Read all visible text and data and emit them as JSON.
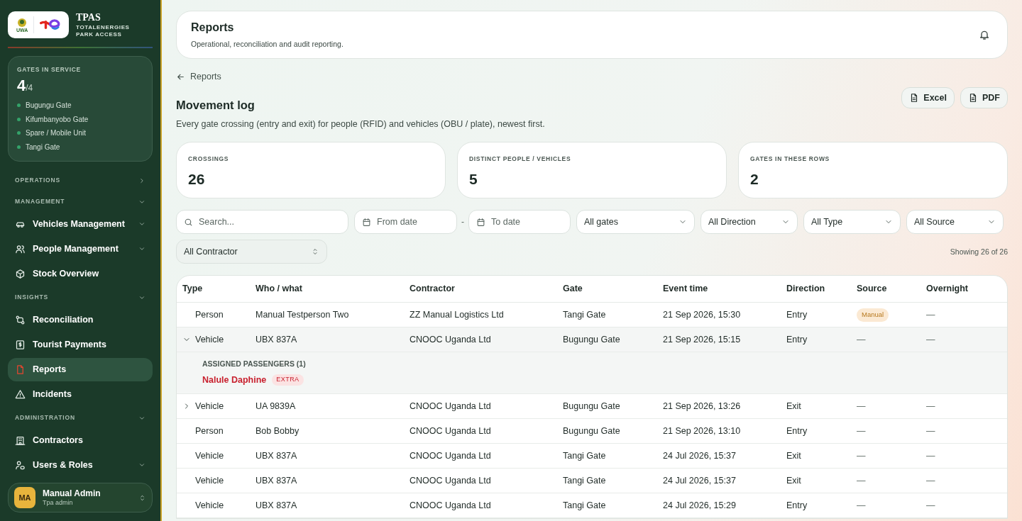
{
  "brand": {
    "title": "TPAS",
    "subtitle_1": "TOTALENERGIES",
    "subtitle_2": "PARK ACCESS",
    "logo_left_text": "UWA"
  },
  "gates_card": {
    "label": "GATES IN SERVICE",
    "count": "4",
    "total": "/4",
    "gates": [
      "Bugungu Gate",
      "Kifumbanyobo Gate",
      "Spare / Mobile Unit",
      "Tangi Gate"
    ]
  },
  "nav": [
    {
      "kind": "section",
      "label": "OPERATIONS",
      "expanded": false
    },
    {
      "kind": "section",
      "label": "MANAGEMENT",
      "expanded": true
    },
    {
      "kind": "item",
      "label": "Vehicles Management",
      "selected": false,
      "submenu": true
    },
    {
      "kind": "item",
      "label": "People Management",
      "selected": false,
      "submenu": true
    },
    {
      "kind": "item",
      "label": "Stock Overview",
      "selected": false,
      "submenu": false
    },
    {
      "kind": "section",
      "label": "INSIGHTS",
      "expanded": true
    },
    {
      "kind": "item",
      "label": "Reconciliation",
      "selected": false,
      "submenu": false
    },
    {
      "kind": "item",
      "label": "Tourist Payments",
      "selected": false,
      "submenu": false
    },
    {
      "kind": "item",
      "label": "Reports",
      "selected": true,
      "submenu": false
    },
    {
      "kind": "item",
      "label": "Incidents",
      "selected": false,
      "submenu": false
    },
    {
      "kind": "section",
      "label": "ADMINISTRATION",
      "expanded": true
    },
    {
      "kind": "item",
      "label": "Contractors",
      "selected": false,
      "submenu": false
    },
    {
      "kind": "item",
      "label": "Users & Roles",
      "selected": false,
      "submenu": true
    }
  ],
  "user": {
    "initials": "MA",
    "name": "Manual Admin",
    "role": "Tpa admin"
  },
  "header": {
    "title": "Reports",
    "subtitle": "Operational, reconciliation and audit reporting."
  },
  "breadcrumb": "Reports",
  "page": {
    "title": "Movement log",
    "description": "Every gate crossing (entry and exit) for people (RFID) and vehicles (OBU / plate), newest first."
  },
  "exports": [
    "Excel",
    "PDF"
  ],
  "stats": [
    {
      "label": "CROSSINGS",
      "value": "26"
    },
    {
      "label": "DISTINCT PEOPLE / VEHICLES",
      "value": "5"
    },
    {
      "label": "GATES IN THESE ROWS",
      "value": "2"
    }
  ],
  "filters": {
    "search": {
      "placeholder": "Search..."
    },
    "from_date": {
      "placeholder": "From date"
    },
    "separator": "-",
    "to_date": {
      "placeholder": "To date"
    },
    "selects": [
      "All gates",
      "All Direction",
      "All Type",
      "All Source"
    ],
    "contractor": "All Contractor",
    "showing": "Showing 26 of 26"
  },
  "table": {
    "columns": [
      "Type",
      "Who / what",
      "Contractor",
      "Gate",
      "Event time",
      "Direction",
      "Source",
      "Overnight"
    ],
    "rows": [
      {
        "type": "Person",
        "who": "Manual Testperson Two",
        "contractor": "ZZ Manual Logistics Ltd",
        "gate": "Tangi Gate",
        "time": "21 Sep 2026, 15:30",
        "direction": "Entry",
        "source": {
          "text": "Manual",
          "kind": "badge"
        },
        "overnight": "—"
      },
      {
        "type": "Vehicle",
        "expanded": true,
        "who": "UBX 837A",
        "contractor": "CNOOC Uganda Ltd",
        "gate": "Bugungu Gate",
        "time": "21 Sep 2026, 15:15",
        "direction": "Entry",
        "source": {
          "text": "—",
          "kind": "plain"
        },
        "overnight": "—",
        "passengers": {
          "label": "ASSIGNED PASSENGERS (1)",
          "people": [
            {
              "name": "Nalule Daphine",
              "tag": "EXTRA"
            }
          ]
        }
      },
      {
        "type": "Vehicle",
        "expanded": false,
        "who": "UA 9839A",
        "contractor": "CNOOC Uganda Ltd",
        "gate": "Bugungu Gate",
        "time": "21 Sep 2026, 13:26",
        "direction": "Exit",
        "source": {
          "text": "—",
          "kind": "plain"
        },
        "overnight": "—"
      },
      {
        "type": "Person",
        "who": "Bob Bobby",
        "contractor": "CNOOC Uganda Ltd",
        "gate": "Bugungu Gate",
        "time": "21 Sep 2026, 13:10",
        "direction": "Entry",
        "source": {
          "text": "—",
          "kind": "plain"
        },
        "overnight": "—"
      },
      {
        "type": "Vehicle",
        "who": "UBX 837A",
        "contractor": "CNOOC Uganda Ltd",
        "gate": "Tangi Gate",
        "time": "24 Jul 2026, 15:37",
        "direction": "Exit",
        "source": {
          "text": "—",
          "kind": "plain"
        },
        "overnight": "—"
      },
      {
        "type": "Vehicle",
        "who": "UBX 837A",
        "contractor": "CNOOC Uganda Ltd",
        "gate": "Tangi Gate",
        "time": "24 Jul 2026, 15:37",
        "direction": "Exit",
        "source": {
          "text": "—",
          "kind": "plain"
        },
        "overnight": "—"
      },
      {
        "type": "Vehicle",
        "who": "UBX 837A",
        "contractor": "CNOOC Uganda Ltd",
        "gate": "Tangi Gate",
        "time": "24 Jul 2026, 15:29",
        "direction": "Entry",
        "source": {
          "text": "—",
          "kind": "plain"
        },
        "overnight": "—"
      }
    ]
  }
}
